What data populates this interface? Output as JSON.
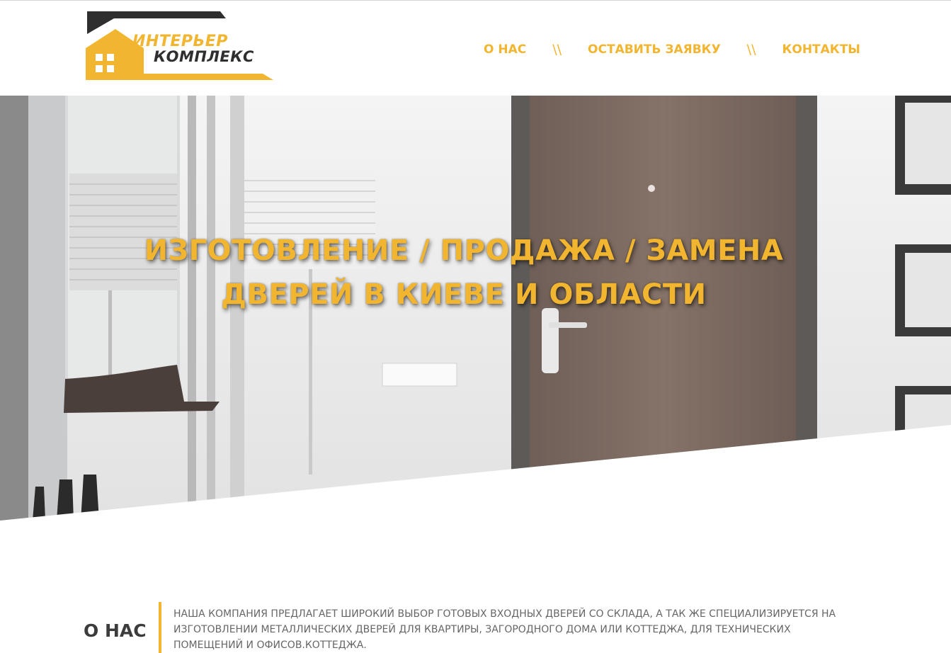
{
  "header": {
    "logo": {
      "line1": "ИНТЕРЬЕР",
      "line2": "КОМПЛЕКС"
    },
    "nav": [
      {
        "label": "О НАС"
      },
      {
        "label": "ОСТАВИТЬ ЗАЯВКУ"
      },
      {
        "label": "КОНТАКТЫ"
      }
    ],
    "separator": "\\\\"
  },
  "hero": {
    "title_line1": "ИЗГОТОВЛЕНИЕ / ПРОДАЖА / ЗАМЕНА",
    "title_line2": "ДВЕРЕЙ В КИЕВЕ И ОБЛАСТИ"
  },
  "about": {
    "title": "О НАС",
    "text": "НАША КОМПАНИЯ ПРЕДЛАГАЕТ ШИРОКИЙ ВЫБОР ГОТОВЫХ ВХОДНЫХ ДВЕРЕЙ СО СКЛАДА, А ТАК ЖЕ СПЕЦИАЛИЗИРУЕТСЯ НА ИЗГОТОВЛЕНИИ МЕТАЛЛИЧЕСКИХ ДВЕРЕЙ ДЛЯ КВАРТИРЫ, ЗАГОРОДНОГО ДОМА ИЛИ КОТТЕДЖА, ДЛЯ ТЕХНИЧЕСКИХ ПОМЕЩЕНИЙ И ОФИСОВ.КОТТЕДЖА."
  },
  "colors": {
    "accent": "#f2b530",
    "dark": "#2f2f2f",
    "door": "#7d6b63"
  }
}
